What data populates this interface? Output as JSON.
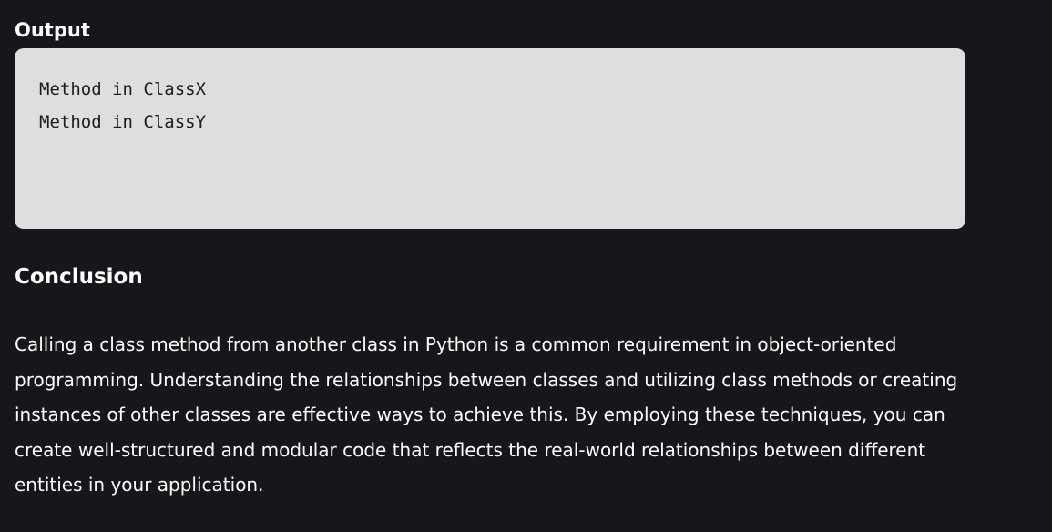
{
  "output": {
    "heading": "Output",
    "lines": [
      "Method in ClassX",
      "Method in ClassY"
    ]
  },
  "conclusion": {
    "heading": "Conclusion",
    "body": "Calling a class method from another class in Python is a common requirement in object-oriented programming. Understanding the relationships between classes and utilizing class methods or creating instances of other classes are effective ways to achieve this. By employing these techniques, you can create well-structured and modular code that reflects the real-world relationships between different entities in your application."
  },
  "colors": {
    "page_background": "#15171b",
    "code_block_background": "#dedede",
    "code_text": "#1e1e1e",
    "text": "#ffffff"
  }
}
